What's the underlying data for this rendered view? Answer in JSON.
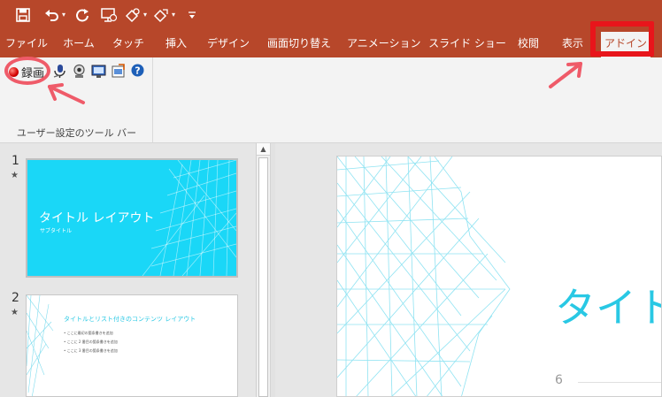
{
  "qat": {
    "icons": [
      "save-icon",
      "undo-icon",
      "redo-icon",
      "start-from-beginning-icon",
      "touch-mode-icon",
      "presenter-icon",
      "customize-icon"
    ]
  },
  "tabs": [
    {
      "label": "ファイル",
      "active": false
    },
    {
      "label": "ホーム",
      "active": false
    },
    {
      "label": "タッチ",
      "active": false
    },
    {
      "label": "挿入",
      "active": false
    },
    {
      "label": "デザイン",
      "active": false
    },
    {
      "label": "画面切り替え",
      "active": false
    },
    {
      "label": "アニメーション",
      "active": false
    },
    {
      "label": "スライド ショー",
      "active": false
    },
    {
      "label": "校閲",
      "active": false
    },
    {
      "label": "表示",
      "active": false
    },
    {
      "label": "アドイン",
      "active": true
    }
  ],
  "ribbon": {
    "record_label": "録画",
    "group_label": "ユーザー設定のツール バー",
    "icons": [
      "microphone-icon",
      "webcam-icon",
      "screen-icon",
      "export-icon",
      "help-icon"
    ]
  },
  "slides": [
    {
      "number": "1",
      "title": "タイトル レイアウト",
      "subtitle": "サブタイトル"
    },
    {
      "number": "2",
      "title": "タイトルとリスト付きのコンテンツ レイアウト",
      "bullets": [
        "ここに最初の箇条書きを追加",
        "ここに 2 番目の箇条書きを追加",
        "ここに 3 番目の箇条書きを追加"
      ]
    }
  ],
  "slide_star": "★",
  "main_slide": {
    "title": "タイトル",
    "page_number": "6"
  },
  "colors": {
    "accent": "#b7472a",
    "slide_cyan": "#1ad7f7",
    "annotation_red": "#e8151b"
  }
}
